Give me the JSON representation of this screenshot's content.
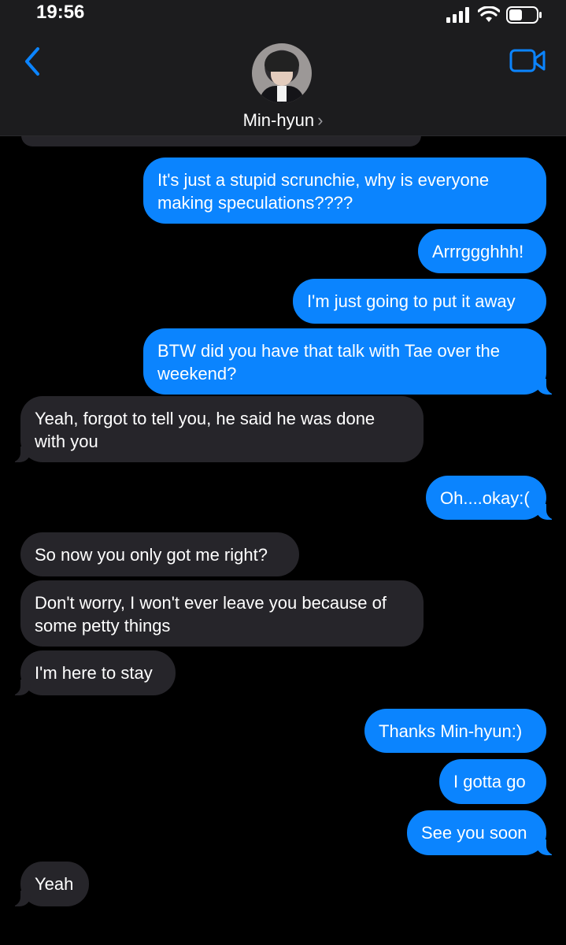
{
  "status_bar": {
    "time": "19:56"
  },
  "header": {
    "contact_name": "Min-hyun",
    "chevron": "›"
  },
  "icons": {
    "back": "chevron-left-icon",
    "video": "video-camera-icon",
    "signal": "signal-bars-icon",
    "wifi": "wifi-icon",
    "battery": "battery-icon"
  },
  "colors": {
    "sent": "#0b84fe",
    "received": "#26252a",
    "accent": "#0b84fe",
    "background": "#000000"
  },
  "messages": [
    {
      "from": "me",
      "text": "It's just a stupid scrunchie, why is everyone making speculations????"
    },
    {
      "from": "me",
      "text": "Arrrggghhh!"
    },
    {
      "from": "me",
      "text": "I'm just going to put it away"
    },
    {
      "from": "me",
      "text": "BTW did you have that talk with Tae over the weekend?"
    },
    {
      "from": "them",
      "text": "Yeah, forgot to tell you, he said he was done with you"
    },
    {
      "from": "me",
      "text": "Oh....okay:("
    },
    {
      "from": "them",
      "text": "So now you only got me right?"
    },
    {
      "from": "them",
      "text": "Don't worry, I won't ever leave you because of some petty things"
    },
    {
      "from": "them",
      "text": "I'm here to stay"
    },
    {
      "from": "me",
      "text": "Thanks Min-hyun:)"
    },
    {
      "from": "me",
      "text": "I gotta go"
    },
    {
      "from": "me",
      "text": "See you soon"
    },
    {
      "from": "them",
      "text": "Yeah"
    }
  ]
}
